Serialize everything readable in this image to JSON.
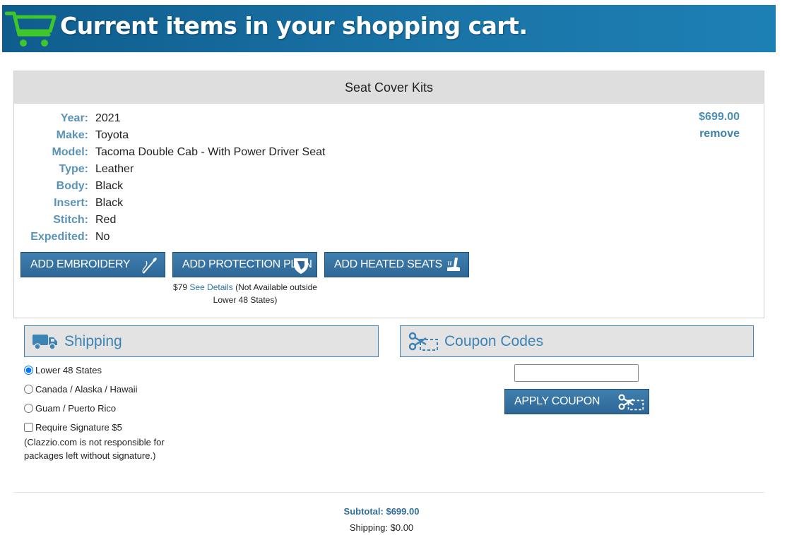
{
  "banner": {
    "title": "Current items in your shopping cart."
  },
  "cart_item": {
    "category": "Seat Cover Kits",
    "price": "$699.00",
    "remove_label": "remove",
    "specs": [
      {
        "label": "Year:",
        "value": "2021"
      },
      {
        "label": "Make:",
        "value": "Toyota"
      },
      {
        "label": "Model:",
        "value": "Tacoma Double Cab - With Power Driver Seat"
      },
      {
        "label": "Type:",
        "value": "Leather"
      },
      {
        "label": "Body:",
        "value": "Black"
      },
      {
        "label": "Insert:",
        "value": "Black"
      },
      {
        "label": "Stitch:",
        "value": "Red"
      },
      {
        "label": "Expedited:",
        "value": "No"
      }
    ],
    "addons": {
      "embroidery": "ADD EMBROIDERY",
      "protection_plan": "ADD PROTECTION PLAN",
      "heated_seats": "ADD HEATED SEATS"
    },
    "plan_note": {
      "price": "$79",
      "link": "See Details",
      "rest": "(Not Available outside Lower 48 States)"
    }
  },
  "shipping": {
    "title": "Shipping",
    "options": [
      {
        "label": "Lower 48 States",
        "selected": true
      },
      {
        "label": "Canada / Alaska / Hawaii",
        "selected": false
      },
      {
        "label": "Guam / Puerto Rico",
        "selected": false
      }
    ],
    "signature": {
      "label": "Require Signature $5",
      "checked": false,
      "note": "(Clazzio.com is not responsible for packages left without signature.)"
    }
  },
  "coupon": {
    "title": "Coupon Codes",
    "input_value": "",
    "apply_label": "APPLY COUPON"
  },
  "totals": {
    "subtotal": "Subtotal: $699.00",
    "shipping": "Shipping: $0.00"
  },
  "colors": {
    "banner": "#1a73a5",
    "cart_icon": "#3ec62a",
    "accent": "#3d84b4",
    "button": "#2e6797"
  },
  "icons": [
    "shopping-cart-icon",
    "needle-thread-icon",
    "shield-icon",
    "heated-seat-icon",
    "truck-icon",
    "coupon-scissors-icon"
  ]
}
